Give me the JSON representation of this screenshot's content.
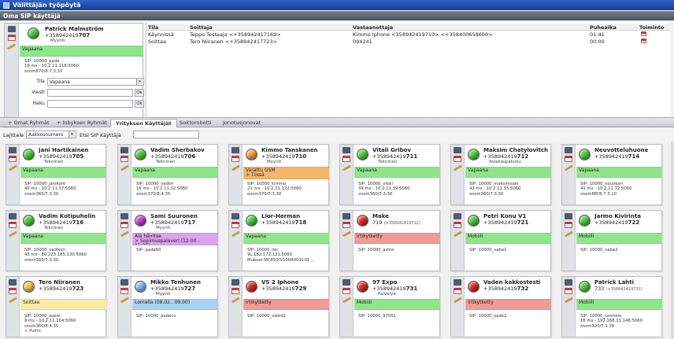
{
  "app": {
    "title": "Välittäjän työpöytä",
    "section": "Oma SIP käyttäjä"
  },
  "own": {
    "name": "Patrick Malmström",
    "number_prefix": "+358942419",
    "number_ext": "707",
    "dept": "Myynti",
    "status": "Vapaana",
    "status_color": "#8fe58a",
    "sip": "SIP: 10000_pada",
    "info1": "19 ms - 10.2.11.118:5060",
    "info2": "snom870/8.7.3.10",
    "tila_label": "Tila",
    "tila_value": "Vapaana",
    "viesti_label": "Viesti",
    "haku_label": "Haku",
    "ok_label": "Ok"
  },
  "calls": {
    "headers": {
      "tila": "Tila",
      "soittaja": "Soittaja",
      "vastaanottaja": "Vastaanottaja",
      "puheaika": "Puheaika",
      "toiminto": "Toiminto"
    },
    "rows": [
      {
        "tila": "Käynnissä",
        "soittaja": "Teppo Testaaja <+358942417169>",
        "vastaanottaja": "Kimmo Iphone <358942419710> <+358400658600>",
        "puheaika": "01:41"
      },
      {
        "tila": "Soittaa",
        "soittaja": "Tero Niiranen <+358942417723>",
        "vastaanottaja": "094241",
        "puheaika": "00:00"
      }
    ]
  },
  "tabs": [
    "+ Omat Ryhmät",
    "+ Inbyksen Ryhmät",
    "Yrityksen Käyttäjät",
    "Soittorobotti",
    "Jonotusjonovat"
  ],
  "active_tab": "Yrityksen Käyttäjät",
  "sortbar": {
    "label": "Lajittele",
    "select": "Aakkosnumero",
    "search_label": "Etsi SIP Käyttäjä"
  },
  "users": [
    {
      "name": "Jani Hartikainen",
      "pre": "+358942419",
      "ext": "705",
      "dept": "Tekninen",
      "status": "Vapaana",
      "ball": "g",
      "strip": "s-g",
      "sip": "SIP: 10000_janikont",
      "l1": "40 ms - 10.2.11.37:5060",
      "l2": "snom360/7.3.30"
    },
    {
      "name": "Vadim Sherbakov",
      "pre": "+358942419",
      "ext": "706",
      "dept": "Tekninen",
      "status": "Vapaana",
      "ball": "g",
      "strip": "s-g",
      "sip": "SIP: 10000_vadim",
      "l1": "16 ms - 10.2.11.32:5060",
      "l2": "snom370/8.4.35"
    },
    {
      "name": "Kimmo Tanskanen",
      "pre": "+358942419",
      "ext": "710",
      "dept": "Myynti",
      "status": "Varattu GSM",
      "status2": "> Tiissä",
      "ball": "o",
      "strip": "s-o",
      "sip": "SIP: 10000_kimmo",
      "l1": "21 ms - 10.2.11.122:5060",
      "l2": "snom370/7.3.30"
    },
    {
      "name": "Vitali Gribov",
      "pre": "+358942419",
      "ext": "711",
      "dept": "Tekninen",
      "status": "Vapaana",
      "ball": "g",
      "strip": "s-g",
      "sip": "SIP: 10000_vitali",
      "l1": "39 ms - 10.2.11.39:5060",
      "l2": "snom360/7.3.30"
    },
    {
      "name": "Maksim Chatylovitch",
      "pre": "+358942419",
      "ext": "712",
      "dept": "Asiakaspalvelu",
      "status": "Vapaana",
      "ball": "g",
      "strip": "s-g",
      "sip": "SIP: 10000_maksimsale",
      "l1": "43 ms - 10.2.11.35:5060",
      "l2": "snom360/7.3.30"
    },
    {
      "name": "Neuvotteluhuone",
      "pre": "+358942419",
      "ext": "714",
      "dept": "",
      "status": "Vapaana",
      "ball": "g",
      "strip": "s-g",
      "sip": "SIP: 10000_neuvkari",
      "l1": "41 ms - 10.2.11.72:5060",
      "l2": "snomMP/8.7.3.10"
    },
    {
      "name": "Vadim Kotipuhelin",
      "pre": "+358942419",
      "ext": "716",
      "dept": "Tekninen",
      "status": "Vapaana",
      "ball": "g",
      "strip": "s-g",
      "sip": "SIP: 10000_vadikoti",
      "l1": "43 ms - 80.223.185.130:5060",
      "l2": "snom360/7.3.30"
    },
    {
      "name": "Sami Suuronen",
      "pre": "+358942419",
      "ext": "717",
      "dept": "Myynti",
      "status": "Älä häiritse",
      "status2": "> Sopimuspalaveri (12:00 - 15:35)",
      "ball": "p",
      "strip": "s-p",
      "sip": "SIP: pada60",
      "l1": "",
      "l2": ""
    },
    {
      "name": "Lior-Herman",
      "pre": "+358942419",
      "ext": "718",
      "dept": "",
      "status": "Vapaana",
      "ball": "g",
      "strip": "s-g",
      "sip": "SIP: 10000_lior",
      "l1": "9L.182.172.121:5060",
      "l2": "Mubeel-MC850/V100R001C01 ..."
    },
    {
      "name": "Make",
      "pre": "719",
      "ext": "",
      "small": "(+358942419712)",
      "dept": "",
      "status": "Irtikytketty",
      "ball": "r",
      "strip": "s-r",
      "sip": "SIP: 10000_asmo",
      "l1": "",
      "l2": ""
    },
    {
      "name": "Petri Konu V1",
      "pre": "+358942419",
      "ext": "721",
      "dept": "",
      "status": "Mobiili",
      "ball": "g",
      "strip": "s-g",
      "sip": "SIP: 10000_vaba1",
      "l1": "",
      "l2": ""
    },
    {
      "name": "Jarmo Kivirinta",
      "pre": "+358942419",
      "ext": "722",
      "dept": "",
      "status": "Mobiili",
      "ball": "g",
      "strip": "s-g",
      "sip": "SIP: 10000_vaba2",
      "l1": "",
      "l2": ""
    },
    {
      "name": "Tero Niiranen",
      "pre": "+358942419",
      "ext": "723",
      "dept": "",
      "status": "Soittaa",
      "ball": "y",
      "strip": "s-y",
      "sip": "SIP: 10000_aspre",
      "l1": "8 ms - 10.2.11.104:5060",
      "l2": "snom360/8.4.35",
      "l3": "> Puimi"
    },
    {
      "name": "Mikko Tenhunen",
      "pre": "+358942419",
      "ext": "727",
      "dept": "Myynti",
      "status": "Lomalla (08.02.. 09.00)",
      "ball": "b",
      "strip": "s-b",
      "sip": "SIP: 10000_padacu",
      "l1": "",
      "l2": ""
    },
    {
      "name": "VS 2 Iphone",
      "pre": "+358942419",
      "ext": "729",
      "dept": "",
      "status": "Irtikytketty",
      "ball": "r",
      "strip": "s-r",
      "sip": "SIP: 10000_vsted2",
      "l1": "",
      "l2": ""
    },
    {
      "name": "97 Expo",
      "pre": "+358942419",
      "ext": "731",
      "dept": "Palvelya",
      "status": "Mobiili",
      "ball": "r",
      "strip": "s-g",
      "sip": "SIP: 10000_97051",
      "l1": "",
      "l2": ""
    },
    {
      "name": "Vaden kakkostesti",
      "pre": "+358942419",
      "ext": "732",
      "dept": "",
      "status": "Irtikytketty",
      "ball": "r",
      "strip": "s-r",
      "sip": "SIP: 10000_vade2",
      "l1": "",
      "l2": ""
    },
    {
      "name": "Patrick Lahti",
      "pre": "733",
      "ext": "",
      "small": "(+358942419731)",
      "dept": "",
      "status": "Mobiili",
      "ball": "g",
      "strip": "s-g",
      "sip": "SIP: 10000_comtele",
      "l1": "16 ms - 192.168.11.148:5060",
      "l2": "snom320/7.1.39"
    }
  ]
}
